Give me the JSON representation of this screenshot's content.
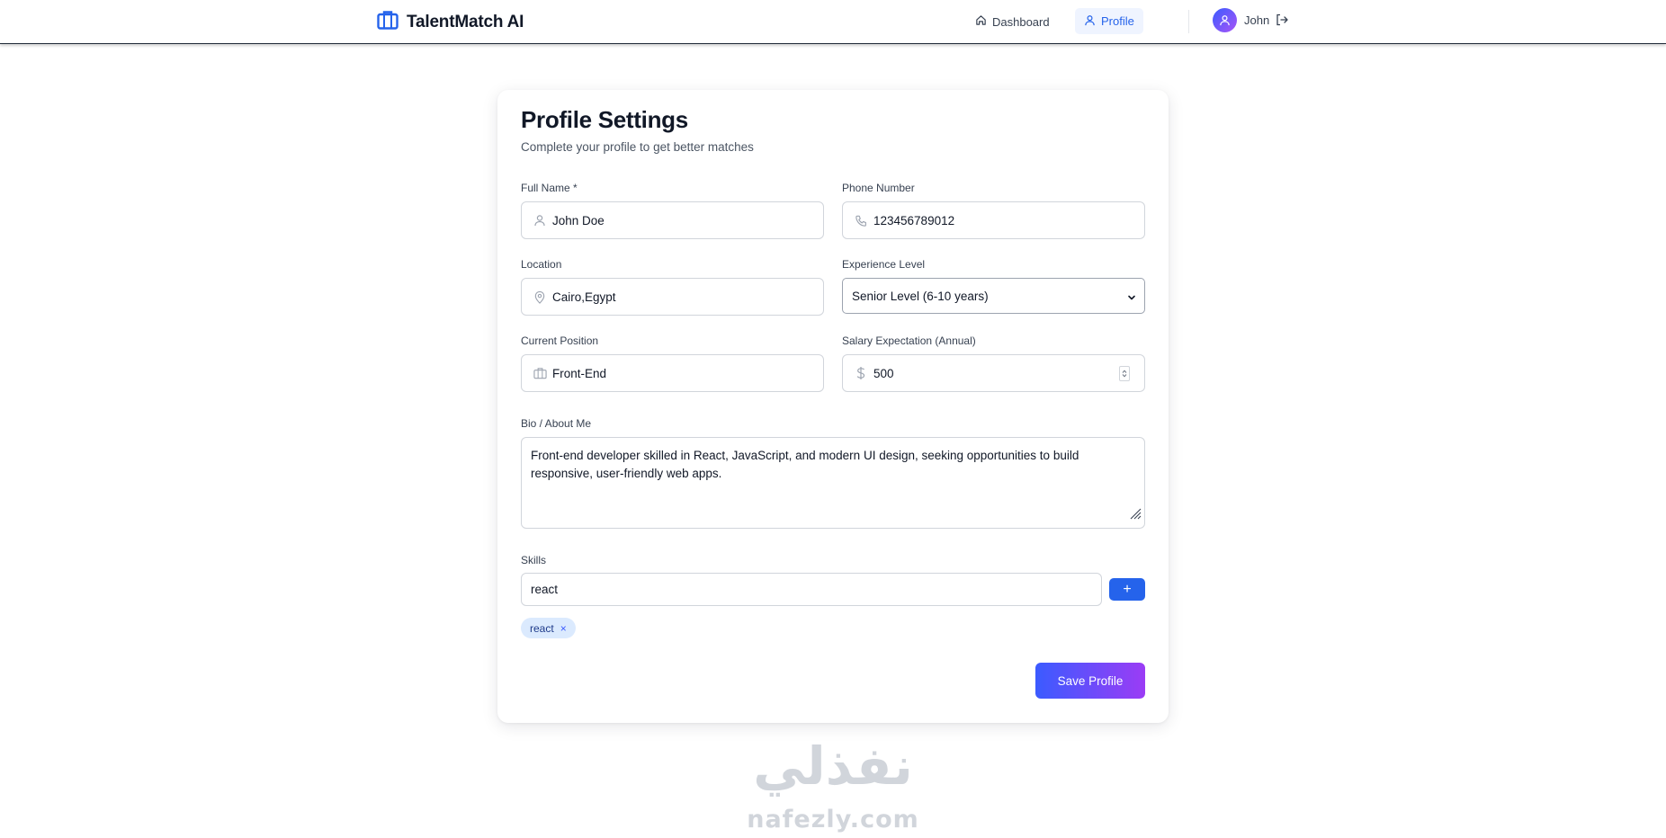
{
  "header": {
    "brand": "TalentMatch AI",
    "nav": {
      "dashboard": "Dashboard",
      "profile": "Profile"
    },
    "user_name": "John"
  },
  "form": {
    "title": "Profile Settings",
    "subtitle": "Complete your profile to get better matches",
    "full_name": {
      "label": "Full Name *",
      "value": "John Doe"
    },
    "phone": {
      "label": "Phone Number",
      "value": "123456789012"
    },
    "location": {
      "label": "Location",
      "value": "Cairo,Egypt"
    },
    "experience": {
      "label": "Experience Level",
      "value": "Senior Level (6-10 years)"
    },
    "position": {
      "label": "Current Position",
      "value": "Front-End"
    },
    "salary": {
      "label": "Salary Expectation (Annual)",
      "value": "500"
    },
    "bio": {
      "label": "Bio / About Me",
      "value": "Front-end developer skilled in React, JavaScript, and modern UI design, seeking opportunities to build responsive, user-friendly web apps."
    },
    "skills": {
      "label": "Skills",
      "input_value": "react",
      "add_label": "+",
      "tags": [
        "react"
      ],
      "remove_label": "×"
    },
    "save_label": "Save Profile"
  },
  "watermark": {
    "arabic": "نفذلي",
    "latin": "nafezly.com"
  },
  "colors": {
    "primary": "#2563eb",
    "gradient_start": "#3b5bff",
    "gradient_end": "#9b3cf5"
  }
}
